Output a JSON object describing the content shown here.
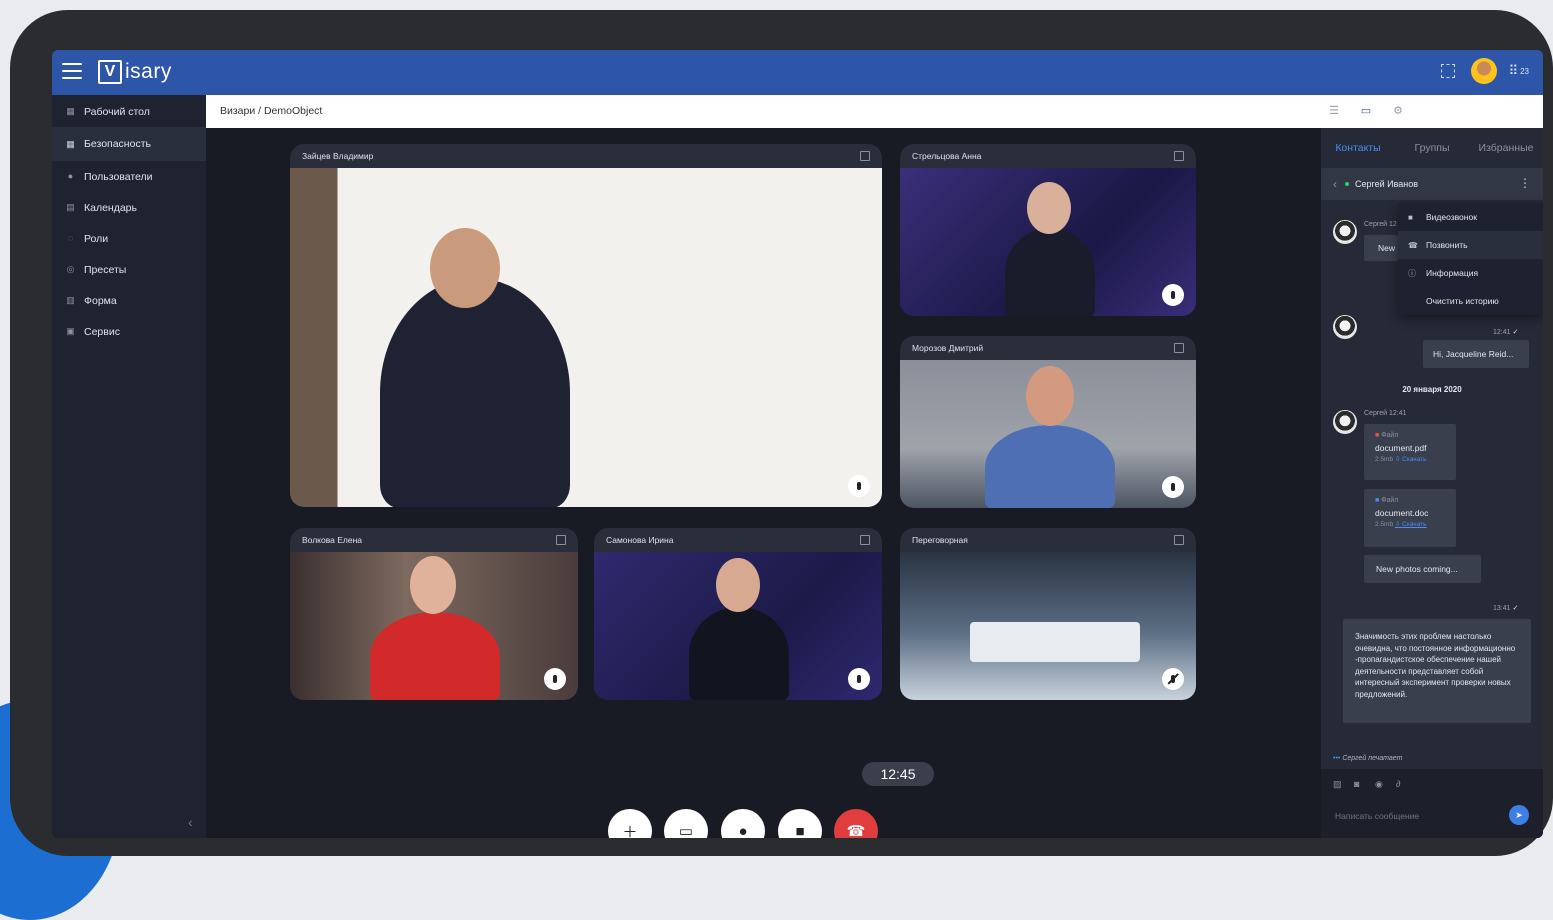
{
  "app": {
    "logo_mark": "V",
    "logo_text": "isary"
  },
  "topbar": {
    "apps_badge": "23"
  },
  "sidebar": {
    "items": [
      {
        "label": "Рабочий стол",
        "icon": "dashboard-icon"
      },
      {
        "label": "Безопасность",
        "icon": "security-icon",
        "active": true
      },
      {
        "label": "Пользователи",
        "icon": "users-icon"
      },
      {
        "label": "Календарь",
        "icon": "calendar-icon"
      },
      {
        "label": "Роли",
        "icon": "roles-icon"
      },
      {
        "label": "Пресеты",
        "icon": "presets-icon"
      },
      {
        "label": "Форма",
        "icon": "form-icon"
      },
      {
        "label": "Сервис",
        "icon": "service-icon"
      }
    ]
  },
  "breadcrumb": "Визари / DemoObject",
  "participants": [
    {
      "name": "Зайцев Владимир",
      "muted": false
    },
    {
      "name": "Стрельцова Анна",
      "muted": false
    },
    {
      "name": "Морозов Дмитрий",
      "muted": false
    },
    {
      "name": "Волкова Елена",
      "muted": false
    },
    {
      "name": "Самонова Ирина",
      "muted": false
    },
    {
      "name": "Переговорная",
      "muted": true
    }
  ],
  "call": {
    "timer": "12:45"
  },
  "chat": {
    "tabs": [
      "Контакты",
      "Группы",
      "Избранные"
    ],
    "contact_name": "Сергей Иванов",
    "menu": [
      "Видеозвонок",
      "Позвонить",
      "Информация",
      "Очистить историю"
    ],
    "msg1_meta": "Сергей 12",
    "msg1_text": "New",
    "msg2_time": "12:41",
    "msg2_text": "Hi, Jacqueline Reid...",
    "date_separator": "20 января 2020",
    "msg3_meta": "Сергей 12:41",
    "file1": {
      "label": "Файл",
      "name": "document.pdf",
      "size": "2.5mb",
      "link": "Скачать"
    },
    "file2": {
      "label": "Файл",
      "name": "document.doc",
      "size": "2.5mb",
      "link": "Скачать"
    },
    "msg4_text": "New photos coming...",
    "msg5_time": "13:41",
    "msg5_text": "Значимость этих проблем настолько очевидна, что постоянное информационно -пропагандистское обеспечение нашей деятельности представляет собой интересный эксперимент проверки новых предложений.",
    "typing": "Сергей печатает",
    "input_placeholder": "Написать сообщение"
  },
  "colors": {
    "accent": "#2d56a8",
    "end_call": "#e23d3d",
    "online": "#2ecc71"
  }
}
